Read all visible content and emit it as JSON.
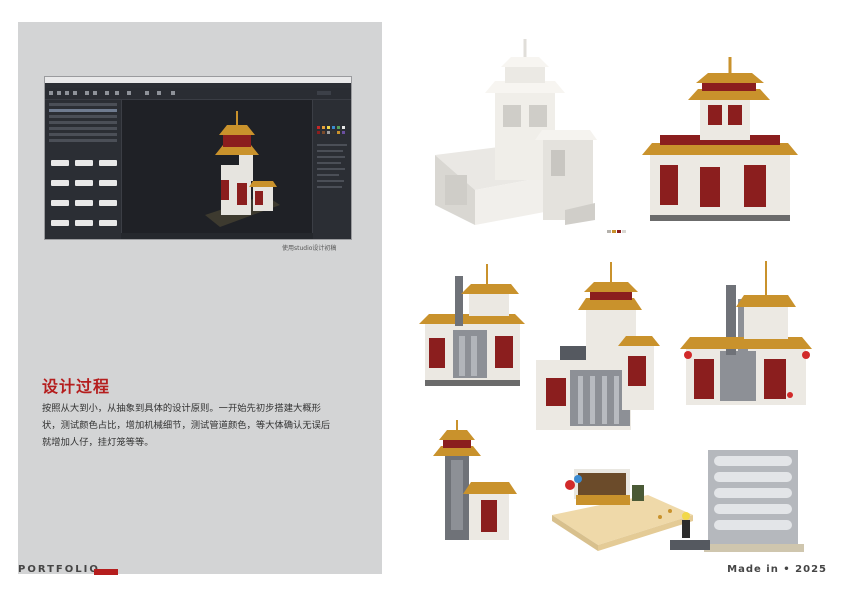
{
  "screenshot_caption": "使用studio设计初稿",
  "section_heading": "设计过程",
  "body_text": "按照从大到小，从抽象到具体的设计原则。一开始先初步搭建大概形状，测试颜色占比，增加机械细节，测试管道颜色，等大体确认无误后就增加人仔，挂灯笼等等。",
  "footer": {
    "portfolio_label": "PORTFOLIO",
    "made_in_label": "Made in • 2025"
  },
  "colors": {
    "accent_red": "#b51e1e",
    "panel_gray": "#d3d4d5",
    "temple_red": "#8b1e1e",
    "temple_gold": "#c9922c",
    "temple_white": "#e8e6e1",
    "pipe_gray": "#7d8085"
  },
  "renders": [
    {
      "name": "white-massing-model-render",
      "icon": "white-temple-model"
    },
    {
      "name": "colored-temple-render",
      "icon": "colored-temple-model"
    },
    {
      "name": "temple-with-machinery-render-1",
      "icon": "temple-machinery-model"
    },
    {
      "name": "temple-with-pipes-render",
      "icon": "temple-pipes-model"
    },
    {
      "name": "temple-with-machinery-render-2",
      "icon": "temple-machinery-lanterns-model"
    },
    {
      "name": "tower-temple-render",
      "icon": "tower-temple-model"
    },
    {
      "name": "market-stall-vignette-render",
      "icon": "market-stall-model"
    },
    {
      "name": "pipe-tower-render",
      "icon": "pipe-tower-model"
    }
  ]
}
